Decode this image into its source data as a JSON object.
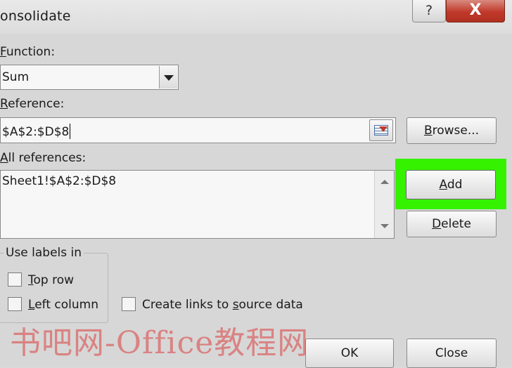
{
  "window": {
    "title": "onsolidate",
    "help_glyph": "?",
    "close_glyph": "X"
  },
  "function": {
    "label_u": "F",
    "label_rest": "unction:",
    "value": "Sum"
  },
  "reference": {
    "label_u": "R",
    "label_rest": "eference:",
    "value": "$A$2:$D$8"
  },
  "browse": {
    "label_u": "B",
    "label_rest": "rowse..."
  },
  "all_refs": {
    "label_u": "A",
    "label_rest": "ll references:",
    "items": [
      "Sheet1!$A$2:$D$8"
    ]
  },
  "add": {
    "label_u": "A",
    "label_rest": "dd"
  },
  "delete": {
    "label_u": "D",
    "label_rest": "elete"
  },
  "labels_group": {
    "legend": "Use labels in",
    "top_row": {
      "label_u": "T",
      "label_rest": "op row",
      "checked": false
    },
    "left_column": {
      "label_u": "L",
      "label_rest": "eft column",
      "checked": false
    }
  },
  "links": {
    "label_pre": "Create links to ",
    "label_u": "s",
    "label_rest": "ource data",
    "checked": false
  },
  "ok": {
    "label": "OK"
  },
  "close": {
    "label": "Close"
  },
  "watermark": "书吧网-Office教程网",
  "colors": {
    "highlight": "#35f200",
    "close_button": "#c0392b"
  }
}
